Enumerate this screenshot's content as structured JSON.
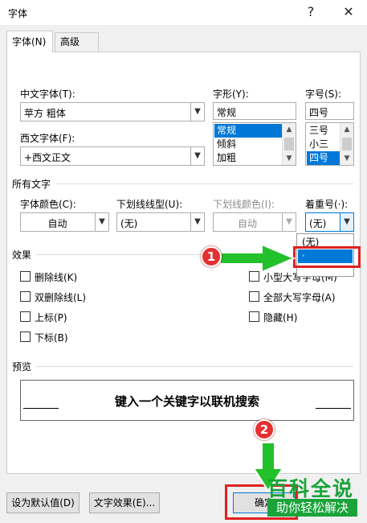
{
  "window": {
    "title": "字体",
    "help_glyph": "?",
    "close_glyph": "✕"
  },
  "tabs": [
    {
      "label": "字体(N)"
    },
    {
      "label": "高级(V)"
    }
  ],
  "font": {
    "cn_label": "中文字体(T):",
    "cn_value": "苹方 粗体",
    "west_label": "西文字体(F):",
    "west_value": "+西文正文",
    "style_label": "字形(Y):",
    "style_value": "常规",
    "style_options": [
      "常规",
      "倾斜",
      "加粗"
    ],
    "size_label": "字号(S):",
    "size_value": "四号",
    "size_options": [
      "三号",
      "小三",
      "四号"
    ]
  },
  "all_text": {
    "section_label": "所有文字",
    "color_label": "字体颜色(C):",
    "color_value": "自动",
    "underline_label": "下划线线型(U):",
    "underline_value": "(无)",
    "ucolor_label": "下划线颜色(I):",
    "ucolor_value": "自动",
    "emphasis_label": "着重号(·):",
    "emphasis_value": "(无)"
  },
  "emphasis_dropdown": {
    "options": [
      "(无)",
      "·"
    ],
    "selected_index": 1
  },
  "effects": {
    "section_label": "效果",
    "left": [
      "删除线(K)",
      "双删除线(L)",
      "上标(P)",
      "下标(B)"
    ],
    "right": [
      "小型大写字母(M)",
      "全部大写字母(A)",
      "隐藏(H)"
    ]
  },
  "preview": {
    "section_label": "预览",
    "text": "键入一个关键字以联机搜索"
  },
  "buttons": {
    "default": "设为默认值(D)",
    "effects": "文字效果(E)...",
    "ok": "确定"
  },
  "annotations": {
    "step1": "1",
    "step2": "2"
  },
  "watermark": {
    "line1": "百科全说",
    "line2": "助你轻松解决"
  },
  "colors": {
    "highlight": "#0078d7",
    "annotation_red": "#e02020",
    "arrow_green": "#22c02a",
    "watermark_green": "#19a33a"
  }
}
